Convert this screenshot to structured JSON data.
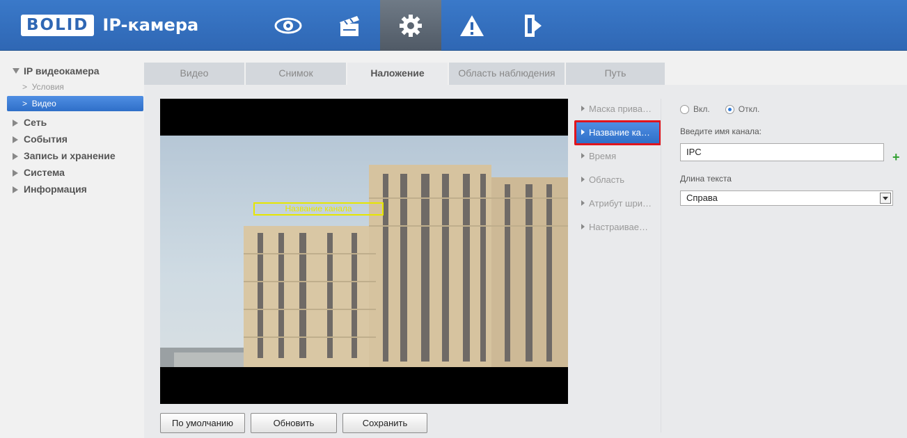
{
  "header": {
    "logo": "BOLID",
    "product": "IP-камера",
    "nav": [
      {
        "icon": "eye-icon",
        "label": ""
      },
      {
        "icon": "clapperboard-icon",
        "label": ""
      },
      {
        "icon": "gear-icon",
        "label": ""
      },
      {
        "icon": "warning-icon",
        "label": ""
      },
      {
        "icon": "exit-icon",
        "label": ""
      }
    ]
  },
  "sidebar": {
    "title": "IP видеокамера",
    "sub": [
      "Условия",
      "Видео"
    ],
    "items": [
      "Сеть",
      "События",
      "Запись и хранение",
      "Система",
      "Информация"
    ]
  },
  "tabs": [
    "Видео",
    "Снимок",
    "Наложение",
    "Область наблюдения",
    "Путь"
  ],
  "overlay_text": "Название канала",
  "menu": [
    "Маска прива…",
    "Название ка…",
    "Время",
    "Область",
    "Атрибут шри…",
    "Настраивае…"
  ],
  "settings": {
    "on_label": "Вкл.",
    "off_label": "Откл.",
    "channel_label": "Введите имя канала:",
    "channel_value": "IPC",
    "align_label": "Длина текста",
    "align_value": "Справа"
  },
  "buttons": {
    "default": "По умолчанию",
    "refresh": "Обновить",
    "save": "Сохранить"
  },
  "colors": {
    "accent": "#2f67b4",
    "highlight": "#e0141d",
    "overlay": "#e6e600"
  }
}
